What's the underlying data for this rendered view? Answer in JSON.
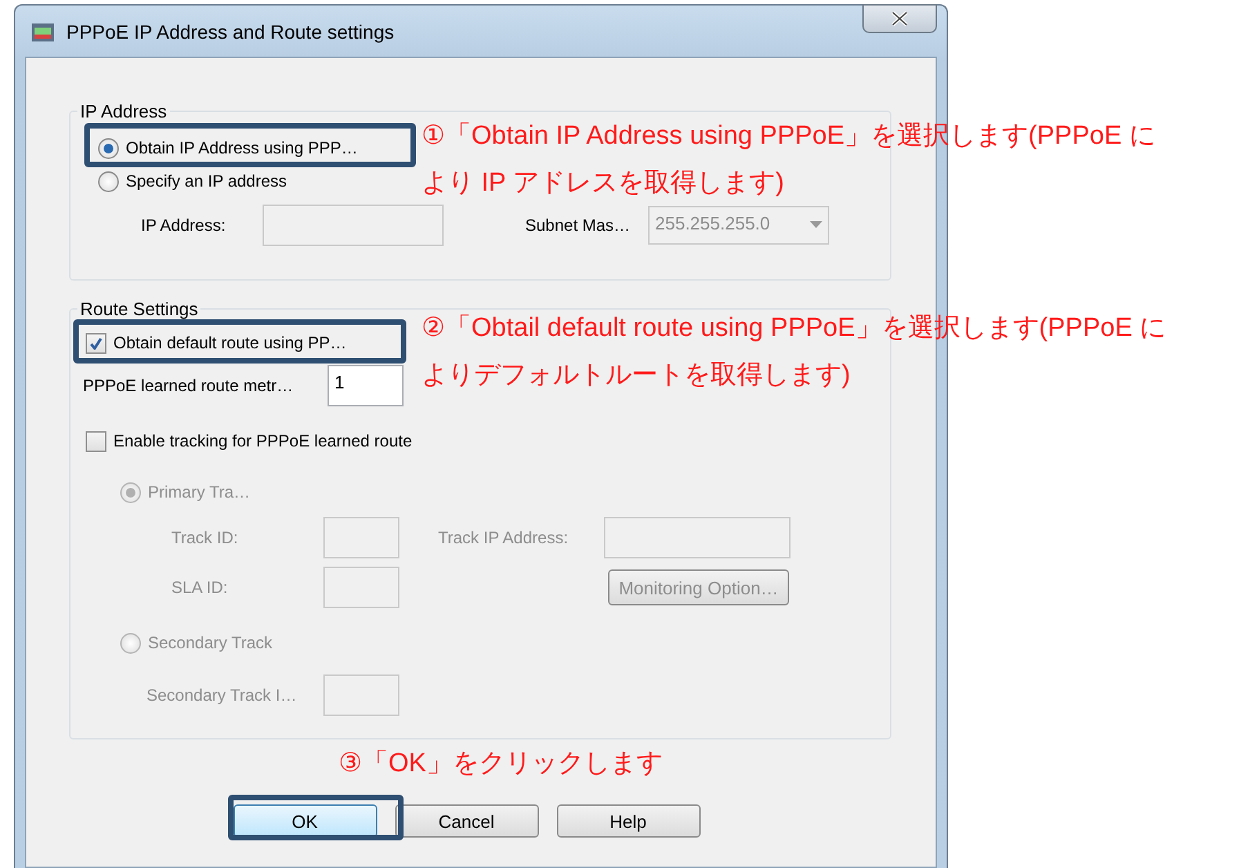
{
  "window": {
    "title": "PPPoE IP Address and Route settings"
  },
  "ip_address": {
    "legend": "IP Address",
    "options": [
      {
        "label": "Obtain IP Address using PPP…",
        "selected": true
      },
      {
        "label": "Specify an IP address",
        "selected": false
      }
    ],
    "ip_field": {
      "label": "IP Address:",
      "disabled": true
    },
    "subnet_field": {
      "label": "Subnet Mas…",
      "value": "255.255.255.0",
      "disabled": true
    }
  },
  "route_settings": {
    "legend": "Route Settings",
    "default_route": {
      "label": "Obtain default route using PP…",
      "checked": true
    },
    "metric": {
      "label": "PPPoE learned route metr…",
      "value": "1"
    },
    "tracking": {
      "label": "Enable tracking for PPPoE learned route",
      "checked": false
    },
    "primary": {
      "label": "Primary Tra…",
      "selected": true
    },
    "track_id": {
      "label": "Track ID:"
    },
    "track_ip": {
      "label": "Track IP Address:"
    },
    "sla_id": {
      "label": "SLA ID:"
    },
    "monitoring_button": "Monitoring Option…",
    "secondary": {
      "label": "Secondary Track",
      "selected": false
    },
    "secondary_id": {
      "label": "Secondary Track I…"
    }
  },
  "buttons": [
    {
      "label": "OK",
      "default": true
    },
    {
      "label": "Cancel",
      "default": false
    },
    {
      "label": "Help",
      "default": false
    }
  ],
  "annotations": [
    {
      "highlight": true,
      "lines": [
        "①「Obtain IP Address using PPPoE」を選択します(PPPoE に",
        "より IP アドレスを取得します)"
      ]
    },
    {
      "highlight": true,
      "lines": [
        "②「Obtail default route using PPPoE」を選択します(PPPoE に",
        "よりデフォルトルートを取得します)"
      ]
    },
    {
      "highlight": true,
      "lines": [
        "③「OK」をクリックします"
      ]
    }
  ]
}
